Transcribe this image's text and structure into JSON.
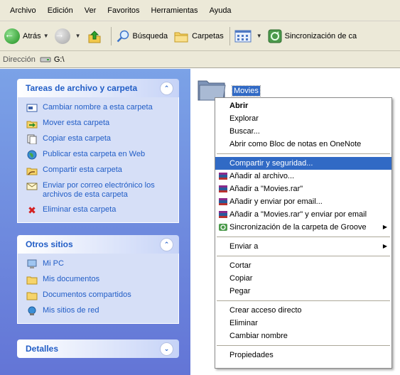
{
  "menubar": {
    "items": [
      "Archivo",
      "Edición",
      "Ver",
      "Favoritos",
      "Herramientas",
      "Ayuda"
    ]
  },
  "toolbar": {
    "back_label": "Atrás",
    "search_label": "Búsqueda",
    "folders_label": "Carpetas",
    "sync_label": "Sincronización de ca"
  },
  "address": {
    "label": "Dirección",
    "value": "G:\\"
  },
  "tasks_panel": {
    "title": "Tareas de archivo y carpeta",
    "items": [
      {
        "label": "Cambiar nombre a esta carpeta",
        "icon": "rename-icon"
      },
      {
        "label": "Mover esta carpeta",
        "icon": "move-icon"
      },
      {
        "label": "Copiar esta carpeta",
        "icon": "copy-icon"
      },
      {
        "label": "Publicar esta carpeta en Web",
        "icon": "globe-icon"
      },
      {
        "label": "Compartir esta carpeta",
        "icon": "share-icon"
      },
      {
        "label": "Enviar por correo electrónico los archivos de esta carpeta",
        "icon": "email-icon"
      },
      {
        "label": "Eliminar esta carpeta",
        "icon": "delete-icon"
      }
    ]
  },
  "other_places": {
    "title": "Otros sitios",
    "items": [
      {
        "label": "Mi PC",
        "icon": "computer-icon"
      },
      {
        "label": "Mis documentos",
        "icon": "folder-icon"
      },
      {
        "label": "Documentos compartidos",
        "icon": "folder-icon"
      },
      {
        "label": "Mis sitios de red",
        "icon": "network-icon"
      }
    ]
  },
  "details_panel": {
    "title": "Detalles"
  },
  "selected_folder": {
    "name": "Movies"
  },
  "context_menu": {
    "open": "Abrir",
    "explore": "Explorar",
    "search": "Buscar...",
    "onenote": "Abrir como Bloc de notas en OneNote",
    "share": "Compartir y seguridad...",
    "add_archive": "Añadir al archivo...",
    "add_rar": "Añadir a \"Movies.rar\"",
    "add_email": "Añadir y enviar por email...",
    "add_rar_email": "Añadir a \"Movies.rar\" y enviar por email",
    "groove_sync": "Sincronización de la carpeta de Groove",
    "send_to": "Enviar a",
    "cut": "Cortar",
    "copy": "Copiar",
    "paste": "Pegar",
    "create_shortcut": "Crear acceso directo",
    "delete": "Eliminar",
    "rename": "Cambiar nombre",
    "properties": "Propiedades"
  },
  "colors": {
    "selection": "#316ac5",
    "task_link": "#215dc6",
    "pane_gradient_top": "#7ba2e7",
    "pane_gradient_bottom": "#6375d6"
  }
}
